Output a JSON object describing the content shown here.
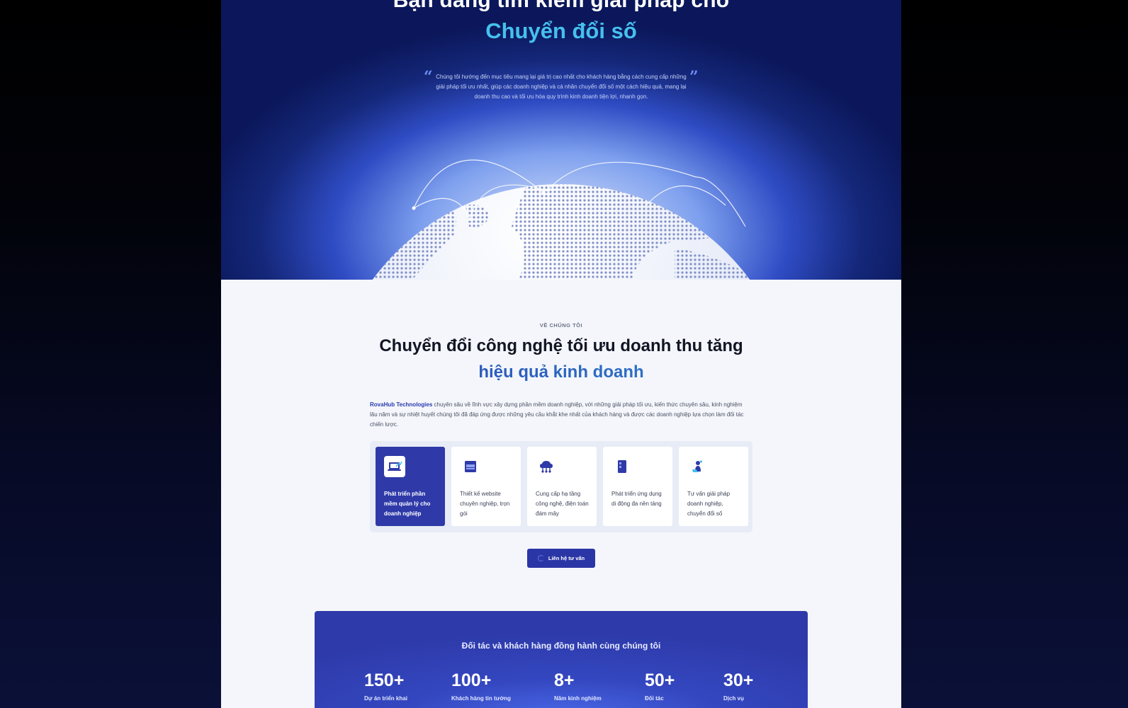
{
  "hero": {
    "title_top": "Bạn đang tìm kiếm giải pháp cho",
    "title_highlight": "Chuyển đổi số",
    "description": "Chúng tôi hướng đến mục tiêu mang lại giá trị cao nhất cho khách hàng bằng cách cung cấp những giải pháp tối ưu nhất, giúp các doanh nghiệp và cá nhân chuyển đổi số một cách hiệu quả, mang lại doanh thu cao và tối ưu hóa quy trình kinh doanh tiện lợi, nhanh gọn."
  },
  "about": {
    "eyebrow": "VỀ CHÚNG TÔI",
    "title_line1": "Chuyển đổi công nghệ tối ưu doanh thu tăng",
    "title_line2": "hiệu quả kinh doanh",
    "brand": "RovaHub Technologies",
    "body": " chuyên sâu về lĩnh vực xây dựng phần mềm doanh nghiệp, với những giải pháp tối ưu, kiến thức chuyên sâu, kinh nghiệm lâu năm và sự nhiệt huyết chúng tôi đã đáp ứng được những yêu cầu khắt khe nhất của khách hàng và được các doanh nghiệp lựa chọn làm đối tác chiến lược.",
    "services": [
      {
        "label": "Phát triển phần mềm quản lý cho doanh nghiệp",
        "icon": "laptop-chart-icon"
      },
      {
        "label": "Thiết kế website chuyên nghiệp, trọn gói",
        "icon": "browser-window-icon"
      },
      {
        "label": "Cung cấp hạ tầng công nghệ, điện toán đám mây",
        "icon": "cloud-network-icon"
      },
      {
        "label": "Phát triển ứng dụng di động đa nền tảng",
        "icon": "mobile-app-icon"
      },
      {
        "label": "Tư vấn giải pháp doanh nghiệp, chuyển đổi số",
        "icon": "consulting-icon"
      }
    ],
    "cta_label": "Liên hệ tư vấn"
  },
  "partners": {
    "title": "Đối tác và khách hàng đồng hành cùng chúng tôi",
    "stats": [
      {
        "value": "150+",
        "label": "Dự án triển khai"
      },
      {
        "value": "100+",
        "label": "Khách hàng tin tưởng"
      },
      {
        "value": "8+",
        "label": "Năm kinh nghiệm"
      },
      {
        "value": "50+",
        "label": "Đối tác"
      },
      {
        "value": "30+",
        "label": "Dịch vụ"
      }
    ]
  },
  "colors": {
    "accent": "#2f3aa8",
    "highlight": "#46c0ee",
    "page_bg": "#f4f6fb"
  }
}
